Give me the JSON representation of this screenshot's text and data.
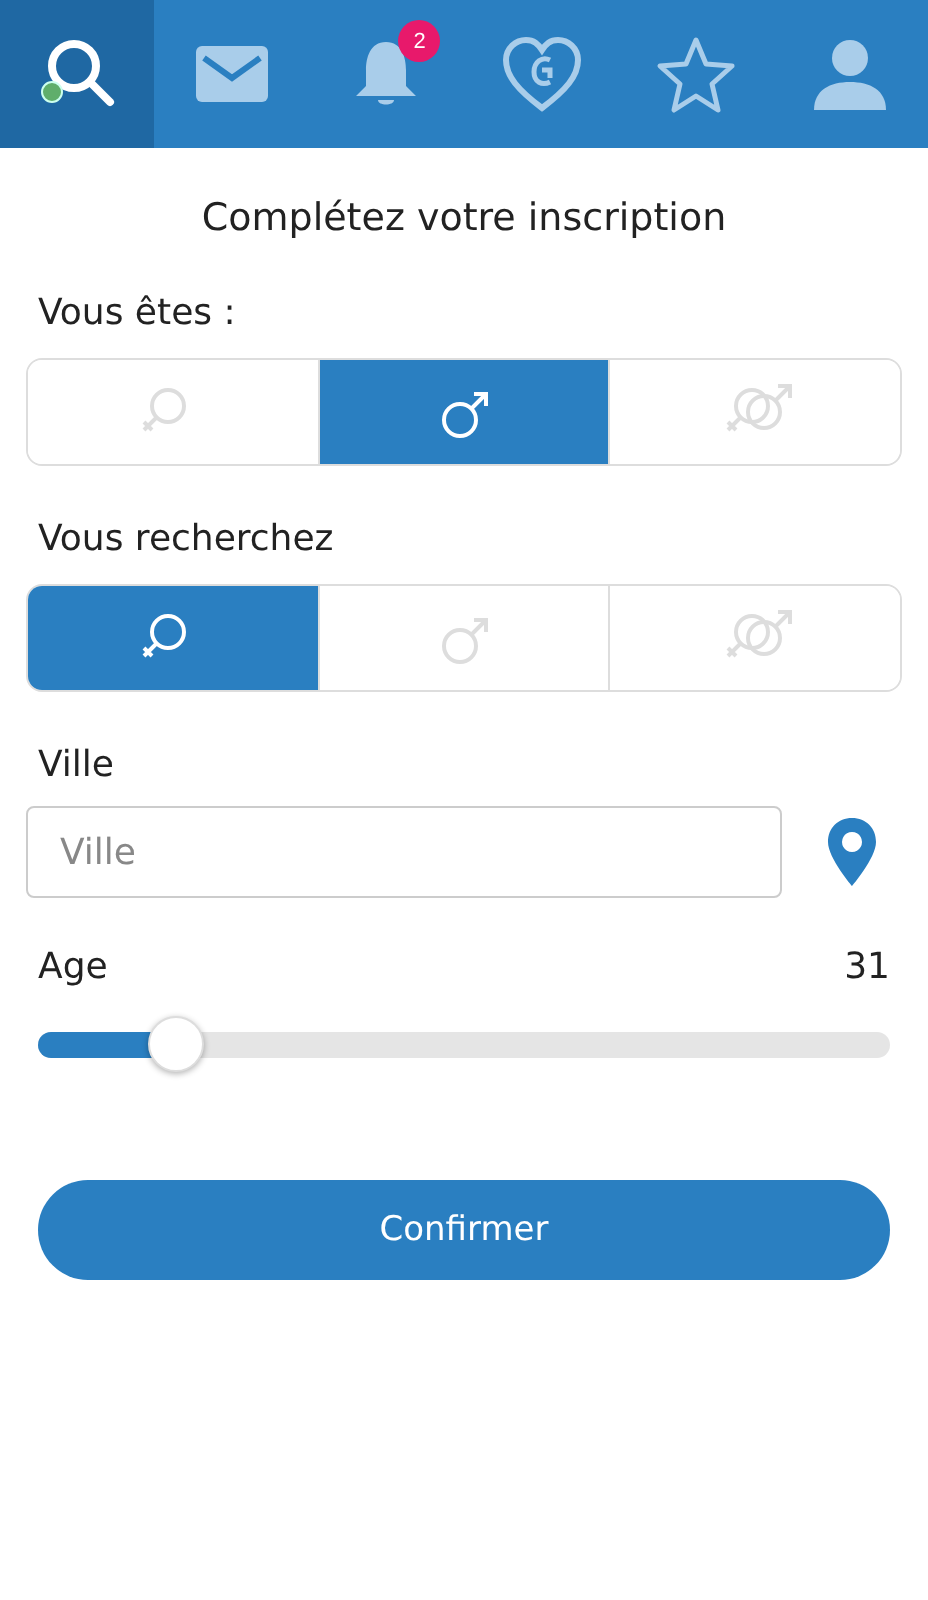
{
  "nav_tabs": [
    {
      "kind": "search",
      "selected": true
    },
    {
      "kind": "mail",
      "selected": false
    },
    {
      "kind": "bell",
      "selected": false,
      "badge": "2"
    },
    {
      "kind": "heart",
      "selected": false
    },
    {
      "kind": "star",
      "selected": false
    },
    {
      "kind": "user",
      "selected": false
    }
  ],
  "title": "Complétez votre inscription",
  "you_are": {
    "label": "Vous êtes :",
    "options": [
      {
        "kind": "female",
        "selected": false
      },
      {
        "kind": "male",
        "selected": true
      },
      {
        "kind": "both",
        "selected": false
      }
    ]
  },
  "looking_for": {
    "label": "Vous recherchez",
    "options": [
      {
        "kind": "female",
        "selected": true
      },
      {
        "kind": "male",
        "selected": false
      },
      {
        "kind": "both",
        "selected": false
      }
    ]
  },
  "city": {
    "label": "Ville",
    "placeholder": "Ville"
  },
  "age": {
    "label": "Age",
    "value": "31",
    "level": 0.16
  },
  "confirm_button": "Confirmer"
}
